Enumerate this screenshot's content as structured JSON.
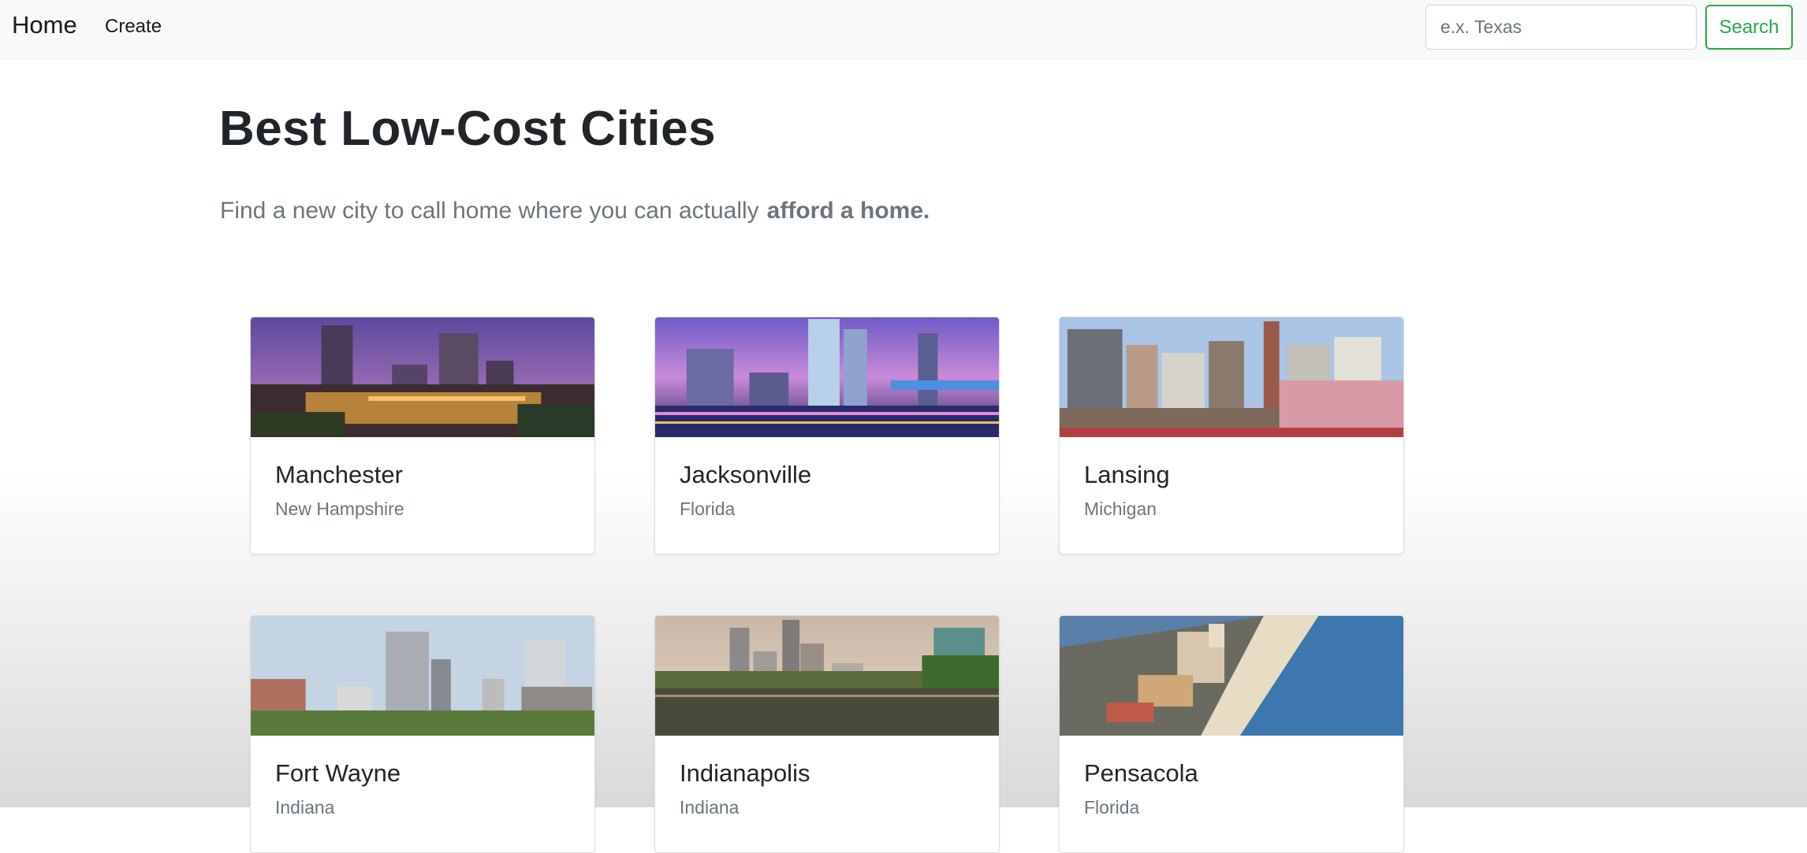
{
  "nav": {
    "brand": "Home",
    "links": [
      "Create"
    ],
    "search_placeholder": "e.x. Texas",
    "search_label": "Search"
  },
  "hero": {
    "title": "Best Low-Cost Cities",
    "lead_text": "Find a new city to call home where you can actually",
    "lead_bold": "afford a home."
  },
  "cities": [
    {
      "city": "Manchester",
      "state": "New Hampshire",
      "image": "manchester-skyline-dusk"
    },
    {
      "city": "Jacksonville",
      "state": "Florida",
      "image": "jacksonville-skyline-river-night"
    },
    {
      "city": "Lansing",
      "state": "Michigan",
      "image": "lansing-skyline-day"
    },
    {
      "city": "Fort Wayne",
      "state": "Indiana",
      "image": "fort-wayne-skyline-day"
    },
    {
      "city": "Indianapolis",
      "state": "Indiana",
      "image": "indianapolis-skyline-river"
    },
    {
      "city": "Pensacola",
      "state": "Florida",
      "image": "pensacola-beach-aerial"
    }
  ]
}
